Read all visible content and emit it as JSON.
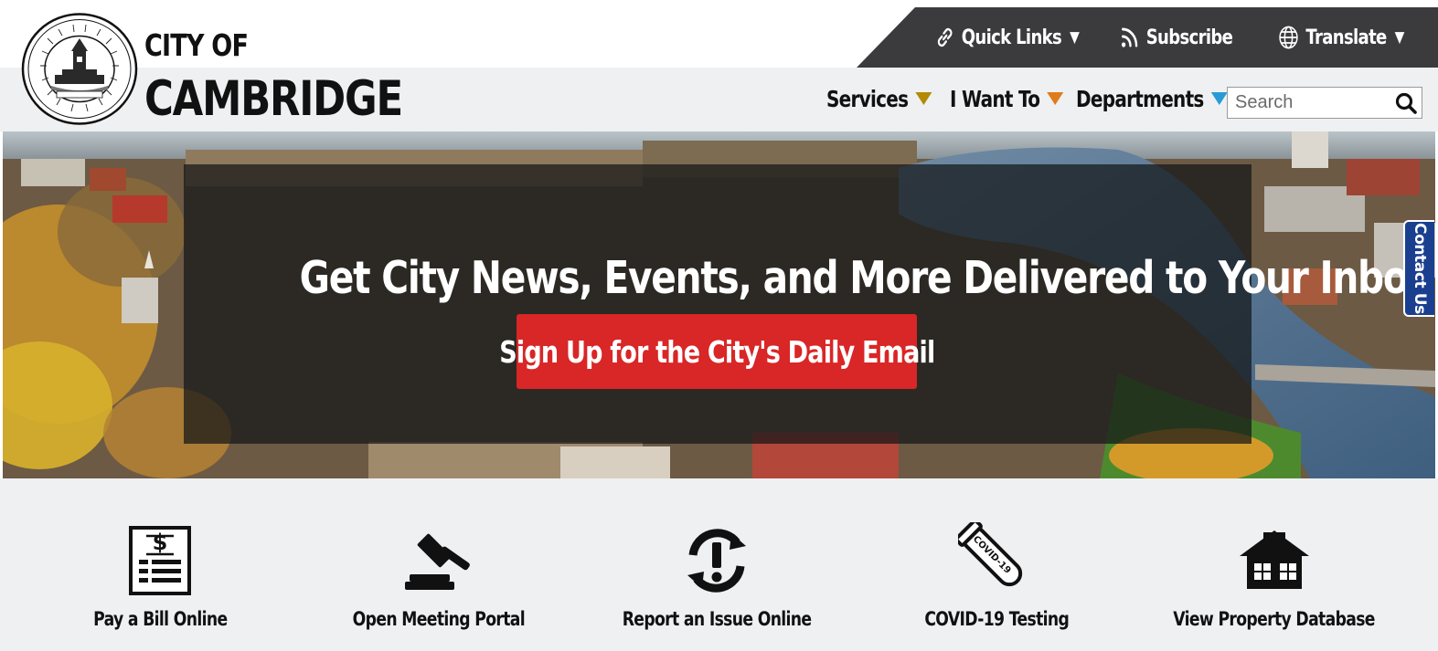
{
  "brand": {
    "line1": "CITY OF",
    "line2": "CAMBRIDGE",
    "seal_icon": "city-seal"
  },
  "utility_nav": {
    "quick_links": "Quick Links",
    "subscribe": "Subscribe",
    "translate": "Translate",
    "caret": "▼"
  },
  "main_nav": {
    "items": [
      {
        "label": "Services",
        "caret_color": "#b38a00"
      },
      {
        "label": "I Want To",
        "caret_color": "#e07b1a"
      },
      {
        "label": "Departments",
        "caret_color": "#2a9ad6"
      }
    ]
  },
  "search": {
    "placeholder": "Search"
  },
  "hero": {
    "title": "Get City News, Events, and More Delivered to Your Inbox",
    "cta": "Sign Up for the City's Daily Email"
  },
  "contact_tab": "Contact Us",
  "quick_actions": [
    {
      "label": "Pay a Bill Online",
      "icon": "bill-icon"
    },
    {
      "label": "Open Meeting Portal",
      "icon": "gavel-icon"
    },
    {
      "label": "Report an Issue Online",
      "icon": "report-issue-icon"
    },
    {
      "label": "COVID-19 Testing",
      "icon": "test-tube-icon",
      "icon_text": "COVID-19"
    },
    {
      "label": "View Property Database",
      "icon": "house-icon"
    }
  ],
  "colors": {
    "utility_bar": "#3b3b3d",
    "cta": "#d92626",
    "contact_tab": "#1b3f8f",
    "band": "#eef0f2"
  }
}
